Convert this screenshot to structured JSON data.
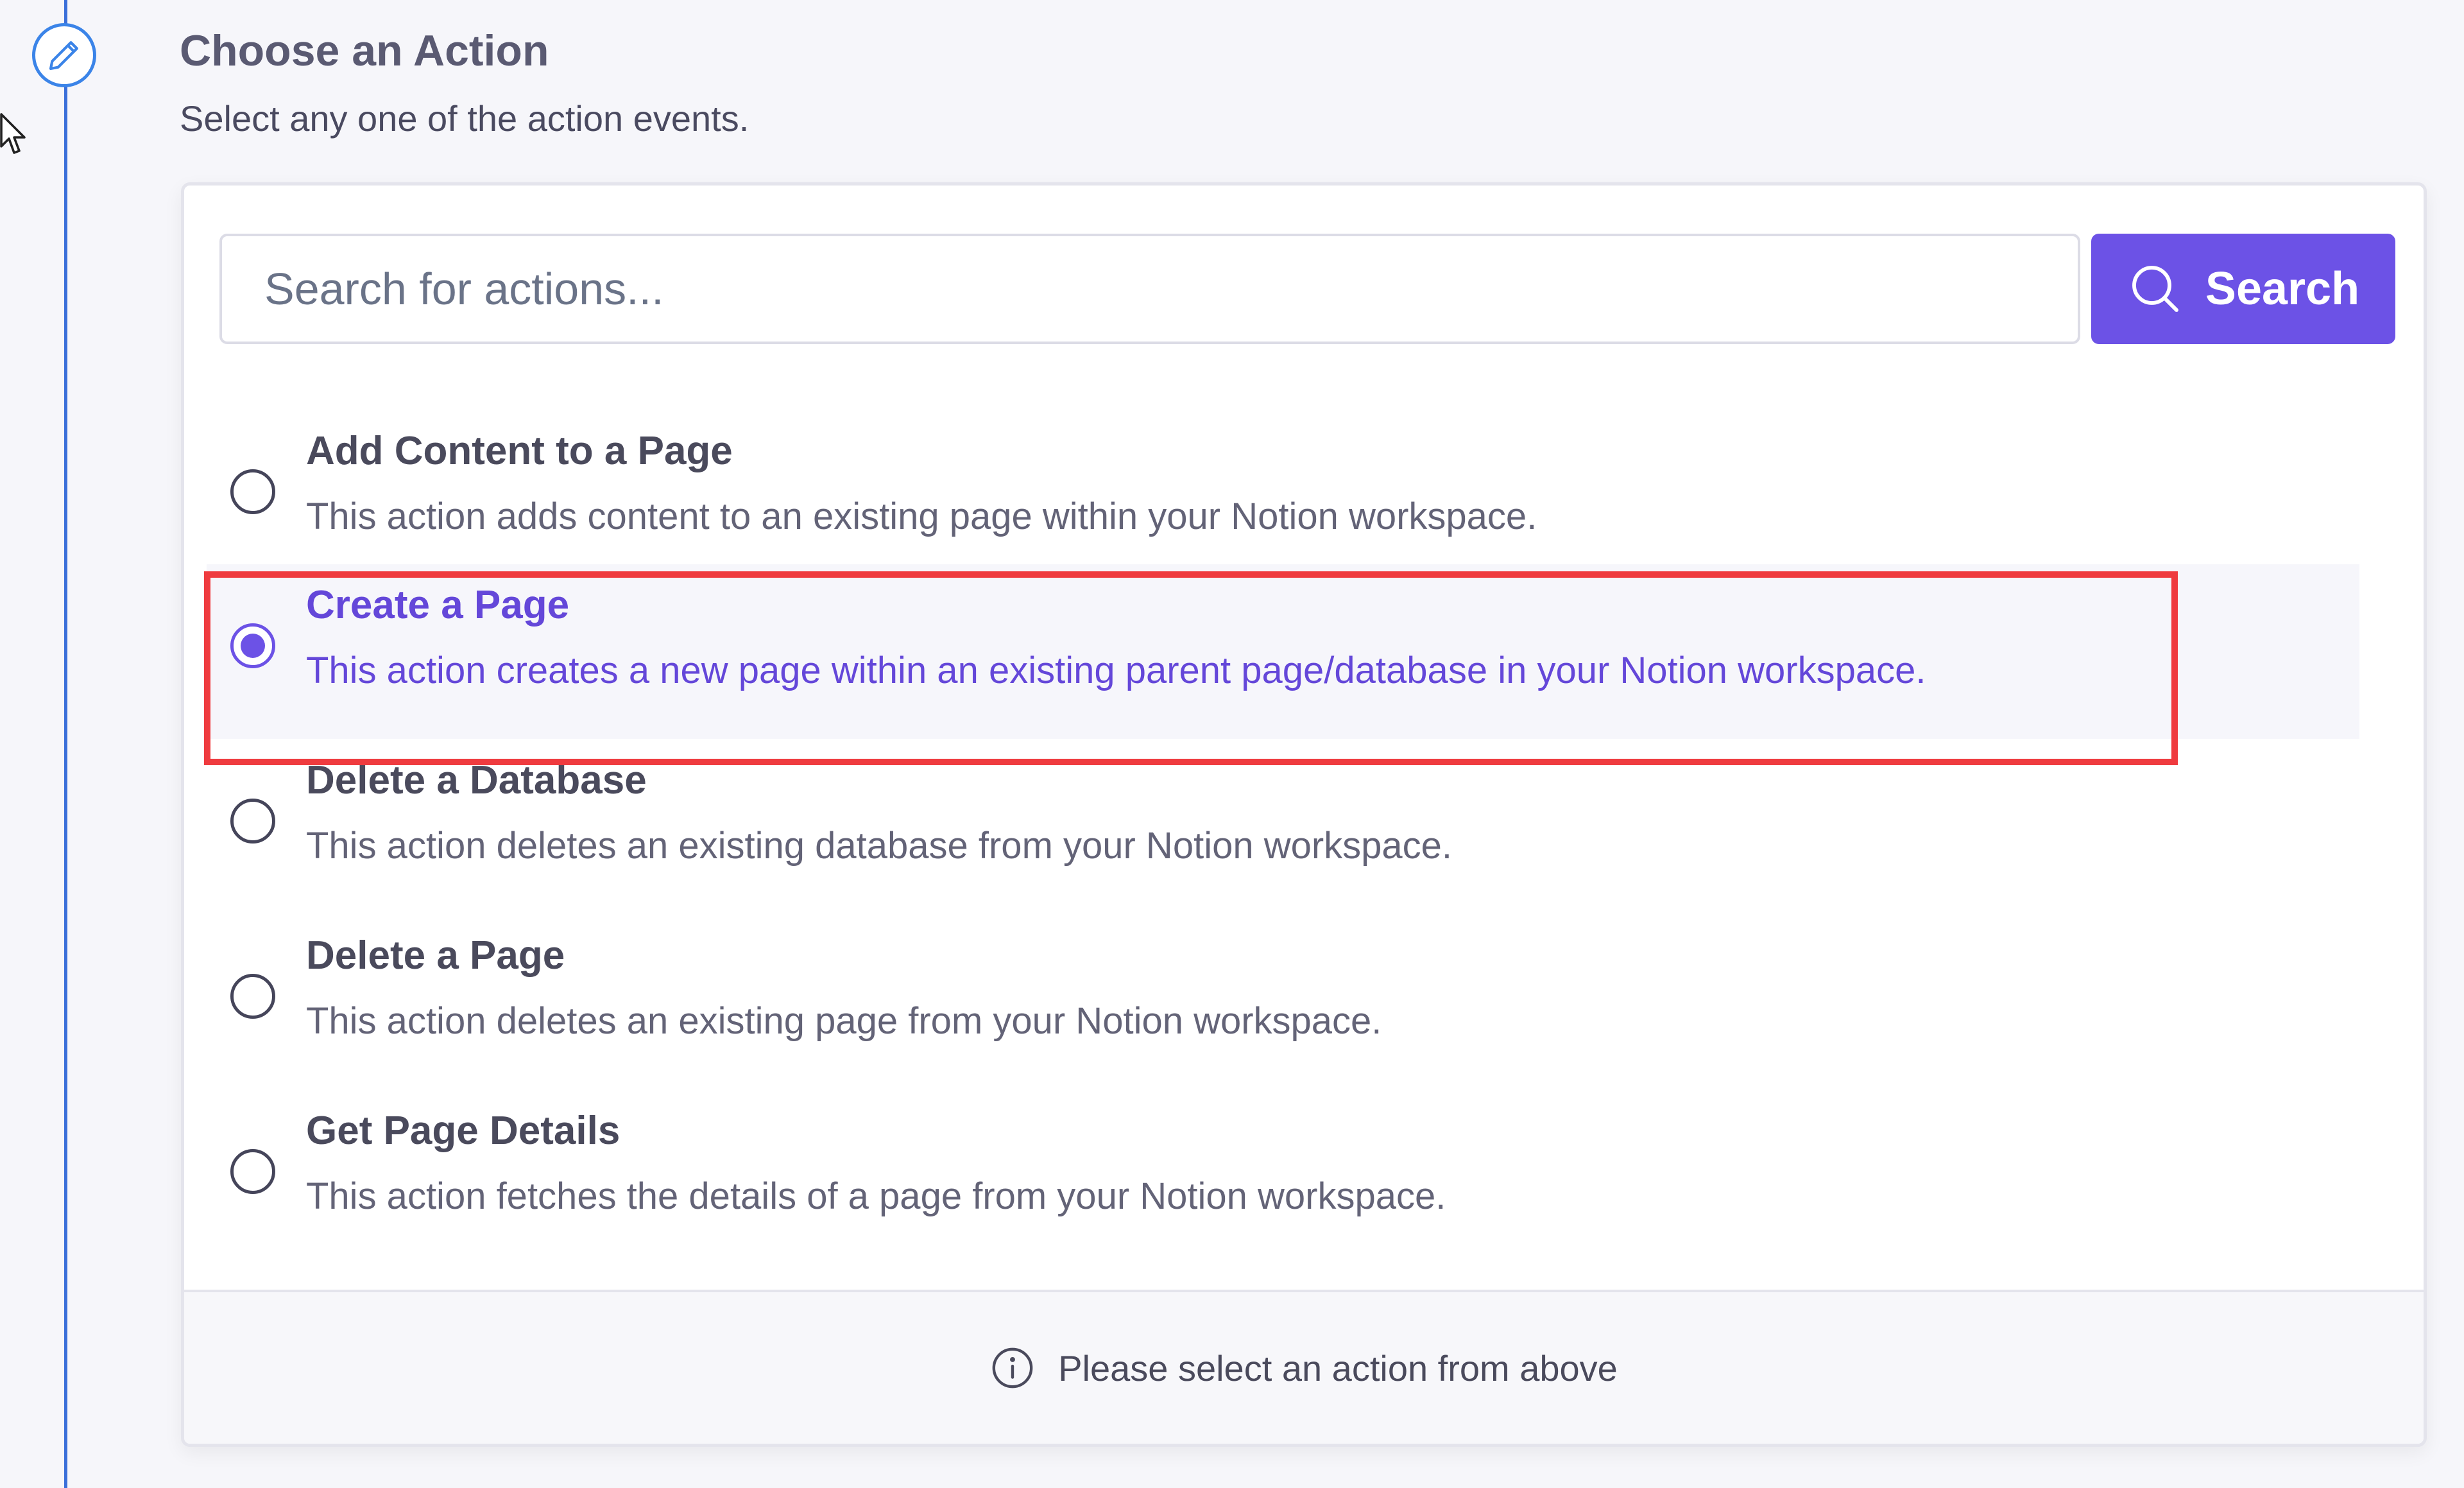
{
  "step": {
    "title": "Choose an Action",
    "subtitle": "Select any one of the action events.",
    "icon": "pencil-icon"
  },
  "search": {
    "placeholder": "Search for actions...",
    "value": "",
    "button_label": "Search",
    "button_icon": "search-icon"
  },
  "options": [
    {
      "title": "Add Content to a Page",
      "description": "This action adds content to an existing page within your Notion workspace.",
      "selected": false
    },
    {
      "title": "Create a Page",
      "description": "This action creates a new page within an existing parent page/database in your Notion workspace.",
      "selected": true
    },
    {
      "title": "Delete a Database",
      "description": "This action deletes an existing database from your Notion workspace.",
      "selected": false
    },
    {
      "title": "Delete a Page",
      "description": "This action deletes an existing page from your Notion workspace.",
      "selected": false
    },
    {
      "title": "Get Page Details",
      "description": "This action fetches the details of a page from your Notion workspace.",
      "selected": false
    }
  ],
  "footer": {
    "message": "Please select an action from above",
    "icon": "info-icon"
  },
  "colors": {
    "accent": "#6c52e6",
    "highlight": "#ef3b3f",
    "timeline": "#3b6fd9"
  }
}
